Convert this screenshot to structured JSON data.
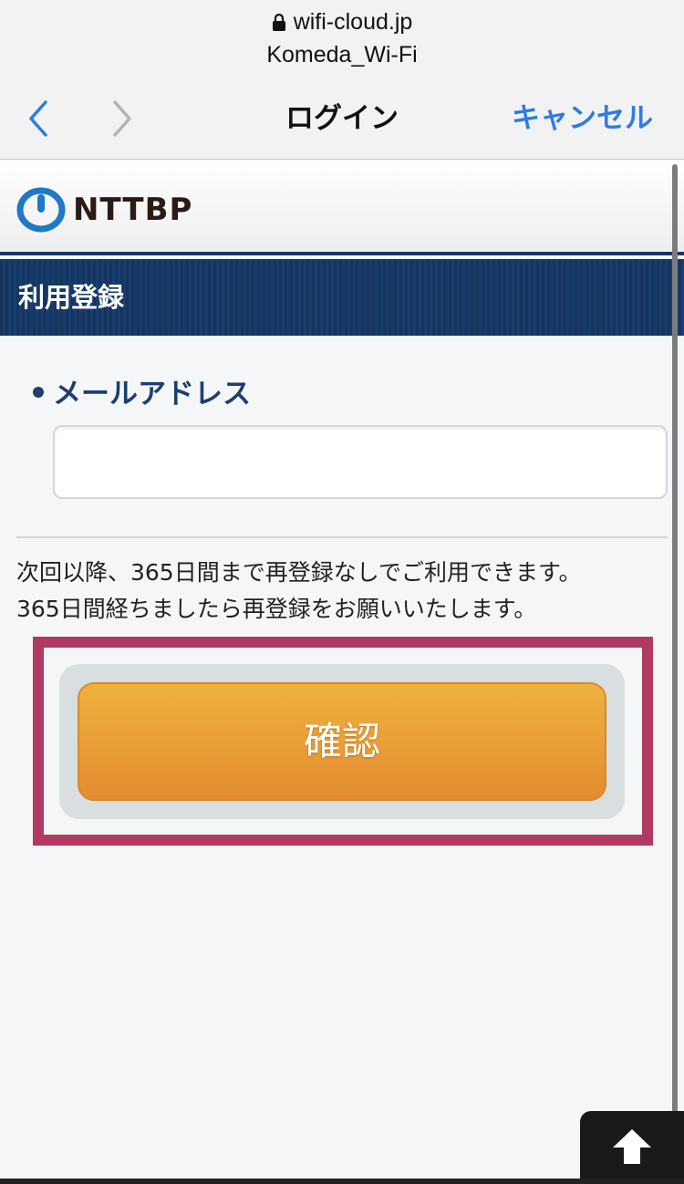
{
  "browser": {
    "url": "wifi-cloud.jp",
    "ssid": "Komeda_Wi-Fi",
    "title": "ログイン",
    "cancel_label": "キャンセル"
  },
  "logo": {
    "text": "NTTBP"
  },
  "section": {
    "title": "利用登録"
  },
  "form": {
    "email_label": "メールアドレス",
    "email_value": "",
    "notice_line1": "次回以降、365日間まで再登録なしでご利用できます。",
    "notice_line2": "365日間経ちましたら再登録をお願いいたします。",
    "confirm_label": "確認"
  },
  "colors": {
    "navy": "#143560",
    "link_blue": "#2f7ce0",
    "button_orange": "#e8a034",
    "highlight": "#b23a62"
  }
}
